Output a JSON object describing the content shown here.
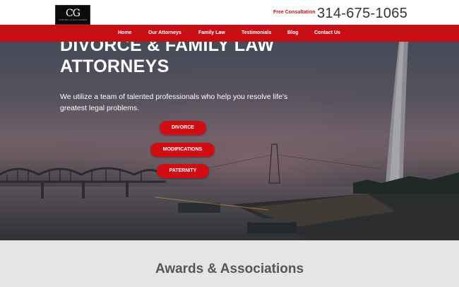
{
  "header": {
    "logo_text": "CG",
    "logo_subtext": "CORDELL & GALLAGHER",
    "free_consultation_label": "Free Consultation",
    "phone": "314-675-1065"
  },
  "nav": {
    "items": [
      {
        "label": "Home"
      },
      {
        "label": "Our Attorneys"
      },
      {
        "label": "Family Law"
      },
      {
        "label": "Testimonials"
      },
      {
        "label": "Blog"
      },
      {
        "label": "Contact Us"
      }
    ]
  },
  "hero": {
    "headline_line1": "DIVORCE & FAMILY LAW",
    "headline_line2": "ATTORNEYS",
    "intro": "We utilize a team of talented professionals who help you resolve life's greatest legal problems.",
    "buttons": [
      {
        "label": "DIVORCE"
      },
      {
        "label": "MODIFICATIONS"
      },
      {
        "label": "PATERNITY"
      }
    ]
  },
  "awards": {
    "title": "Awards & Associations"
  },
  "colors": {
    "brand_red": "#c80e15",
    "button_red": "#d10d14",
    "text_dark": "#333333"
  }
}
